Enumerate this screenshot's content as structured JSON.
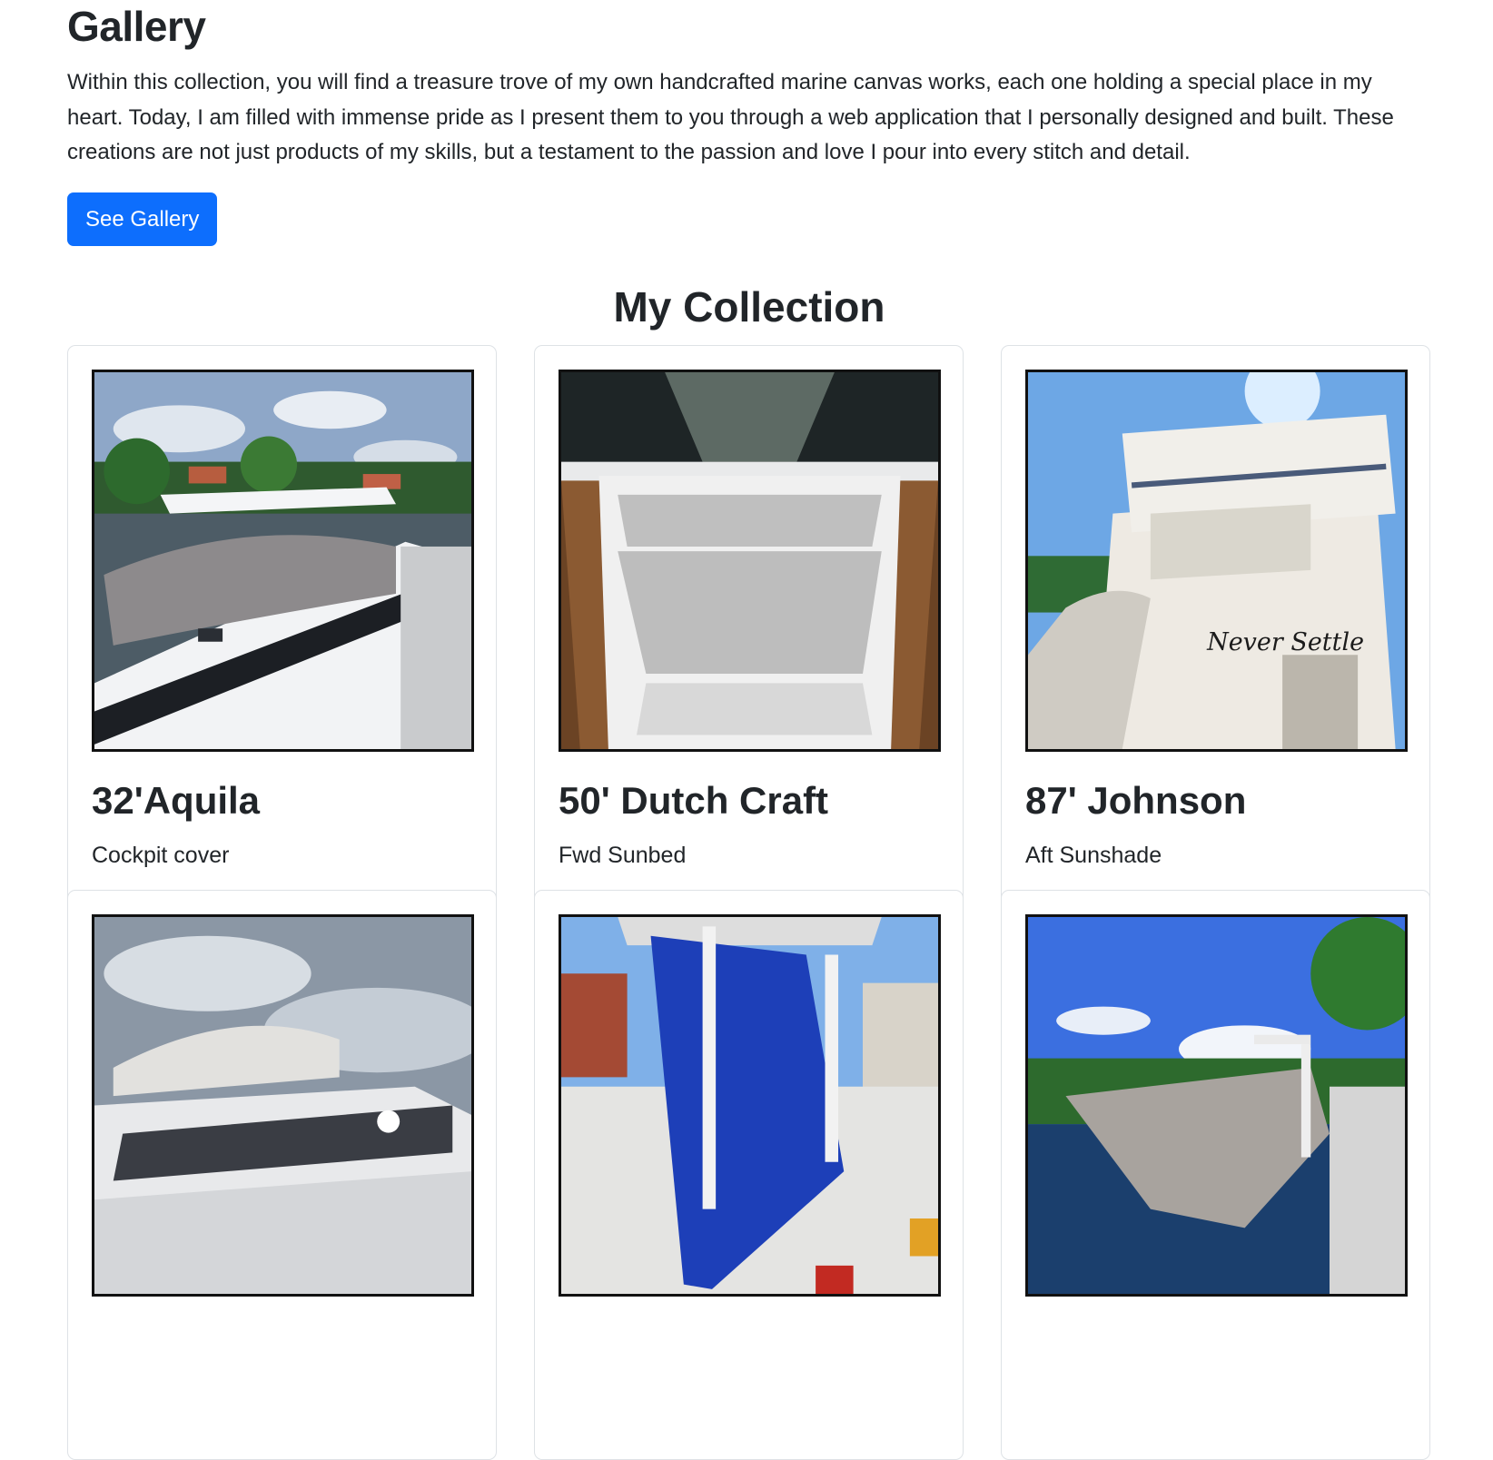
{
  "header": {
    "title": "Gallery",
    "intro": "Within this collection, you will find a treasure trove of my own handcrafted marine canvas works, each one holding a special place in my heart. Today, I am filled with immense pride as I present them to you through a web application that I personally designed and built. These creations are not just products of my skills, but a testament to the passion and love I pour into every stitch and detail.",
    "button_label": "See Gallery"
  },
  "collection": {
    "title": "My Collection",
    "cards": [
      {
        "title": "32'Aquila",
        "text": "Cockpit cover"
      },
      {
        "title": "50' Dutch Craft",
        "text": "Fwd Sunbed"
      },
      {
        "title": "87' Johnson",
        "text": "Aft Sunshade"
      },
      {
        "title": "",
        "text": ""
      },
      {
        "title": "",
        "text": ""
      },
      {
        "title": "",
        "text": ""
      }
    ]
  },
  "colors": {
    "accent": "#0d6efd",
    "text": "#212529",
    "card_border": "#dee2e6"
  }
}
